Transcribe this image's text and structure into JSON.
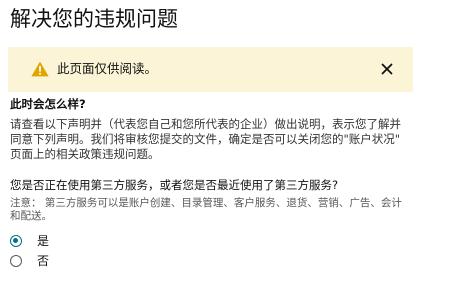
{
  "page": {
    "title": "解决您的违规问题"
  },
  "alert": {
    "icon": "warning-icon",
    "text": "此页面仅供阅读。",
    "close_icon": "close-icon",
    "background": "#fcf4d6",
    "icon_color": "#e0a500"
  },
  "content": {
    "heading": "此时会怎么样?",
    "description_lines": [
      "请查看以下声明并（代表您自己和您所代表的企业）做出说明，表示您了解并",
      "同意下列声明。我们将审核您提交的文件，确定是否可以关闭您的\"账户状况\"",
      "页面上的相关政策违规问题。"
    ],
    "question": "您是否正在使用第三方服务，或者您是否最近使用了第三方服务?",
    "note_lines": [
      "注意：  第三方服务可以是账户创建、目录管理、客户服务、退货、营销、广告、会计",
      "和配送。"
    ]
  },
  "options": [
    {
      "label": "是",
      "selected": true
    },
    {
      "label": "否",
      "selected": false
    }
  ],
  "colors": {
    "radio_accent": "#007185"
  }
}
